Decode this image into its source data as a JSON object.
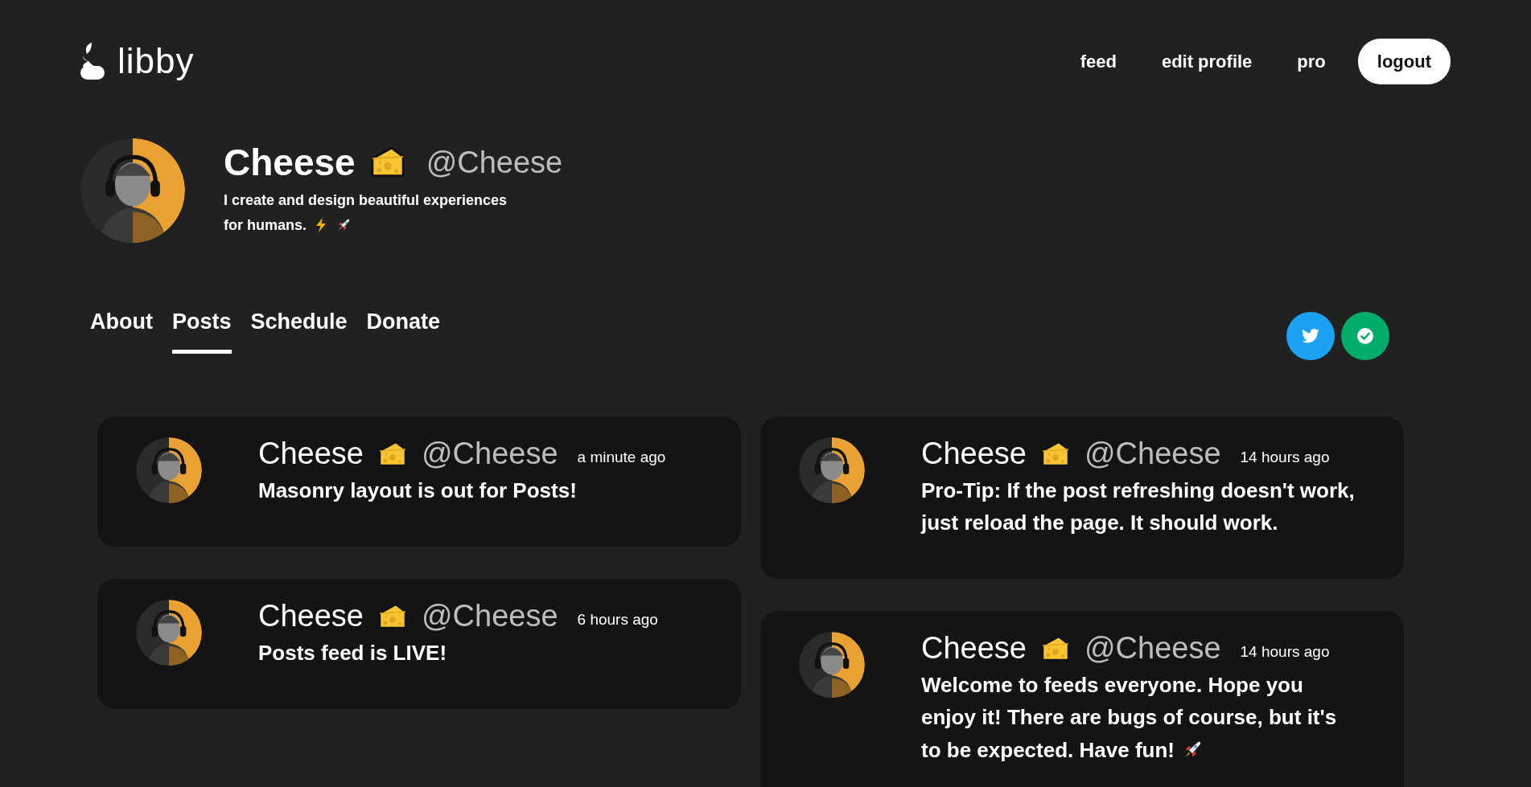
{
  "brand": "libby",
  "nav": [
    {
      "label": "feed",
      "kind": "link"
    },
    {
      "label": "edit profile",
      "kind": "link"
    },
    {
      "label": "pro",
      "kind": "link"
    },
    {
      "label": "logout",
      "kind": "button"
    }
  ],
  "profile": {
    "name": "Cheese",
    "handle": "@Cheese",
    "bio_lines": [
      "I create and design beautiful experiences",
      "for humans."
    ],
    "bio_lightning": true,
    "bio_rocket": true
  },
  "tabs": [
    {
      "label": "About",
      "selected": false
    },
    {
      "label": "Posts",
      "selected": true
    },
    {
      "label": "Schedule",
      "selected": false
    },
    {
      "label": "Donate",
      "selected": false
    }
  ],
  "social": [
    {
      "kind": "twitter",
      "color": "#1da1f2"
    },
    {
      "kind": "verified",
      "color": "#00ac6a"
    }
  ],
  "posts": [
    {
      "name": "Cheese",
      "handle": "@Cheese",
      "time": "a minute ago",
      "lines": [
        "Masonry layout is out for Posts!"
      ]
    },
    {
      "name": "Cheese",
      "handle": "@Cheese",
      "time": "14 hours ago",
      "lines": [
        "Pro-Tip: If the post refreshing doesn't work,",
        "just reload the page. It should work."
      ]
    },
    {
      "name": "Cheese",
      "handle": "@Cheese",
      "time": "6 hours ago",
      "lines": [
        "Posts feed is LIVE!"
      ]
    },
    {
      "name": "Cheese",
      "handle": "@Cheese",
      "time": "14 hours ago",
      "lines": [
        "Welcome to feeds everyone. Hope you",
        "enjoy it! There are bugs of course, but it's",
        "to be expected. Have fun!"
      ],
      "rocket": true
    }
  ]
}
